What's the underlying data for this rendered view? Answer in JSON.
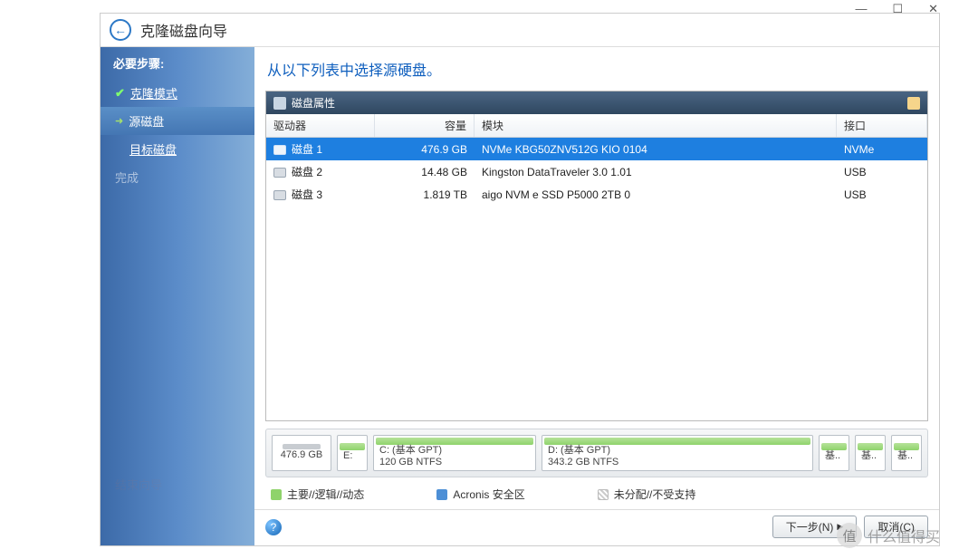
{
  "titlebar": {
    "minimize": "—",
    "maximize": "☐",
    "close": "✕"
  },
  "header": {
    "title": "克隆磁盘向导"
  },
  "sidebar": {
    "heading": "必要步骤:",
    "steps": [
      {
        "kind": "done",
        "icon": "✔",
        "label": "克隆模式"
      },
      {
        "kind": "current",
        "icon": "➜",
        "label": "源磁盘"
      },
      {
        "kind": "sub",
        "icon": "",
        "label": "目标磁盘"
      },
      {
        "kind": "future",
        "icon": "",
        "label": "完成"
      }
    ],
    "cloud": "结束向导"
  },
  "main": {
    "instruction": "从以下列表中选择源硬盘。",
    "panel_title": "磁盘属性",
    "columns": {
      "drive": "驱动器",
      "capacity": "容量",
      "model": "模块",
      "iface": "接口"
    },
    "rows": [
      {
        "drive": "磁盘 1",
        "capacity": "476.9 GB",
        "model": "NVMe KBG50ZNV512G KIO 0104",
        "iface": "NVMe",
        "selected": true
      },
      {
        "drive": "磁盘 2",
        "capacity": "14.48 GB",
        "model": "Kingston DataTraveler 3.0 1.01",
        "iface": "USB",
        "selected": false
      },
      {
        "drive": "磁盘 3",
        "capacity": "1.819 TB",
        "model": "aigo NVM e SSD P5000 2TB 0",
        "iface": "USB",
        "selected": false
      }
    ],
    "partitions": {
      "total": "476.9 GB",
      "e_label": "E:",
      "c": {
        "label": "C: (基本 GPT)",
        "detail": "120 GB  NTFS"
      },
      "d": {
        "label": "D: (基本 GPT)",
        "detail": "343.2 GB  NTFS"
      },
      "tail": [
        "基..",
        "基..",
        "基.."
      ]
    },
    "legend": {
      "primary": "主要//逻辑//动态",
      "acronis": "Acronis 安全区",
      "unalloc": "未分配//不受支持"
    }
  },
  "footer": {
    "next": "下一步(N)",
    "cancel": "取消(C)"
  },
  "watermark": {
    "icon": "值",
    "text": "什么值得买"
  }
}
